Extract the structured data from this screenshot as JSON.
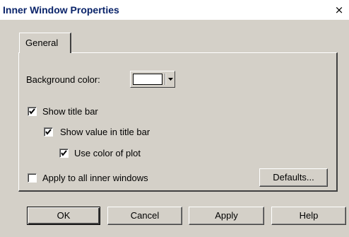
{
  "window": {
    "title": "Inner Window Properties",
    "close_glyph": "×"
  },
  "tabs": [
    {
      "label": "General",
      "selected": true
    }
  ],
  "general": {
    "background_color_label": "Background color:",
    "background_color_value": "#ffffff",
    "show_title_bar": {
      "label": "Show title bar",
      "checked": true
    },
    "show_value_in_title_bar": {
      "label": "Show value in title bar",
      "checked": true
    },
    "use_color_of_plot": {
      "label": "Use color of plot",
      "checked": true
    },
    "apply_to_all": {
      "label": "Apply to all inner windows",
      "checked": false
    },
    "defaults_label": "Defaults..."
  },
  "buttons": {
    "ok": "OK",
    "cancel": "Cancel",
    "apply": "Apply",
    "help": "Help"
  }
}
